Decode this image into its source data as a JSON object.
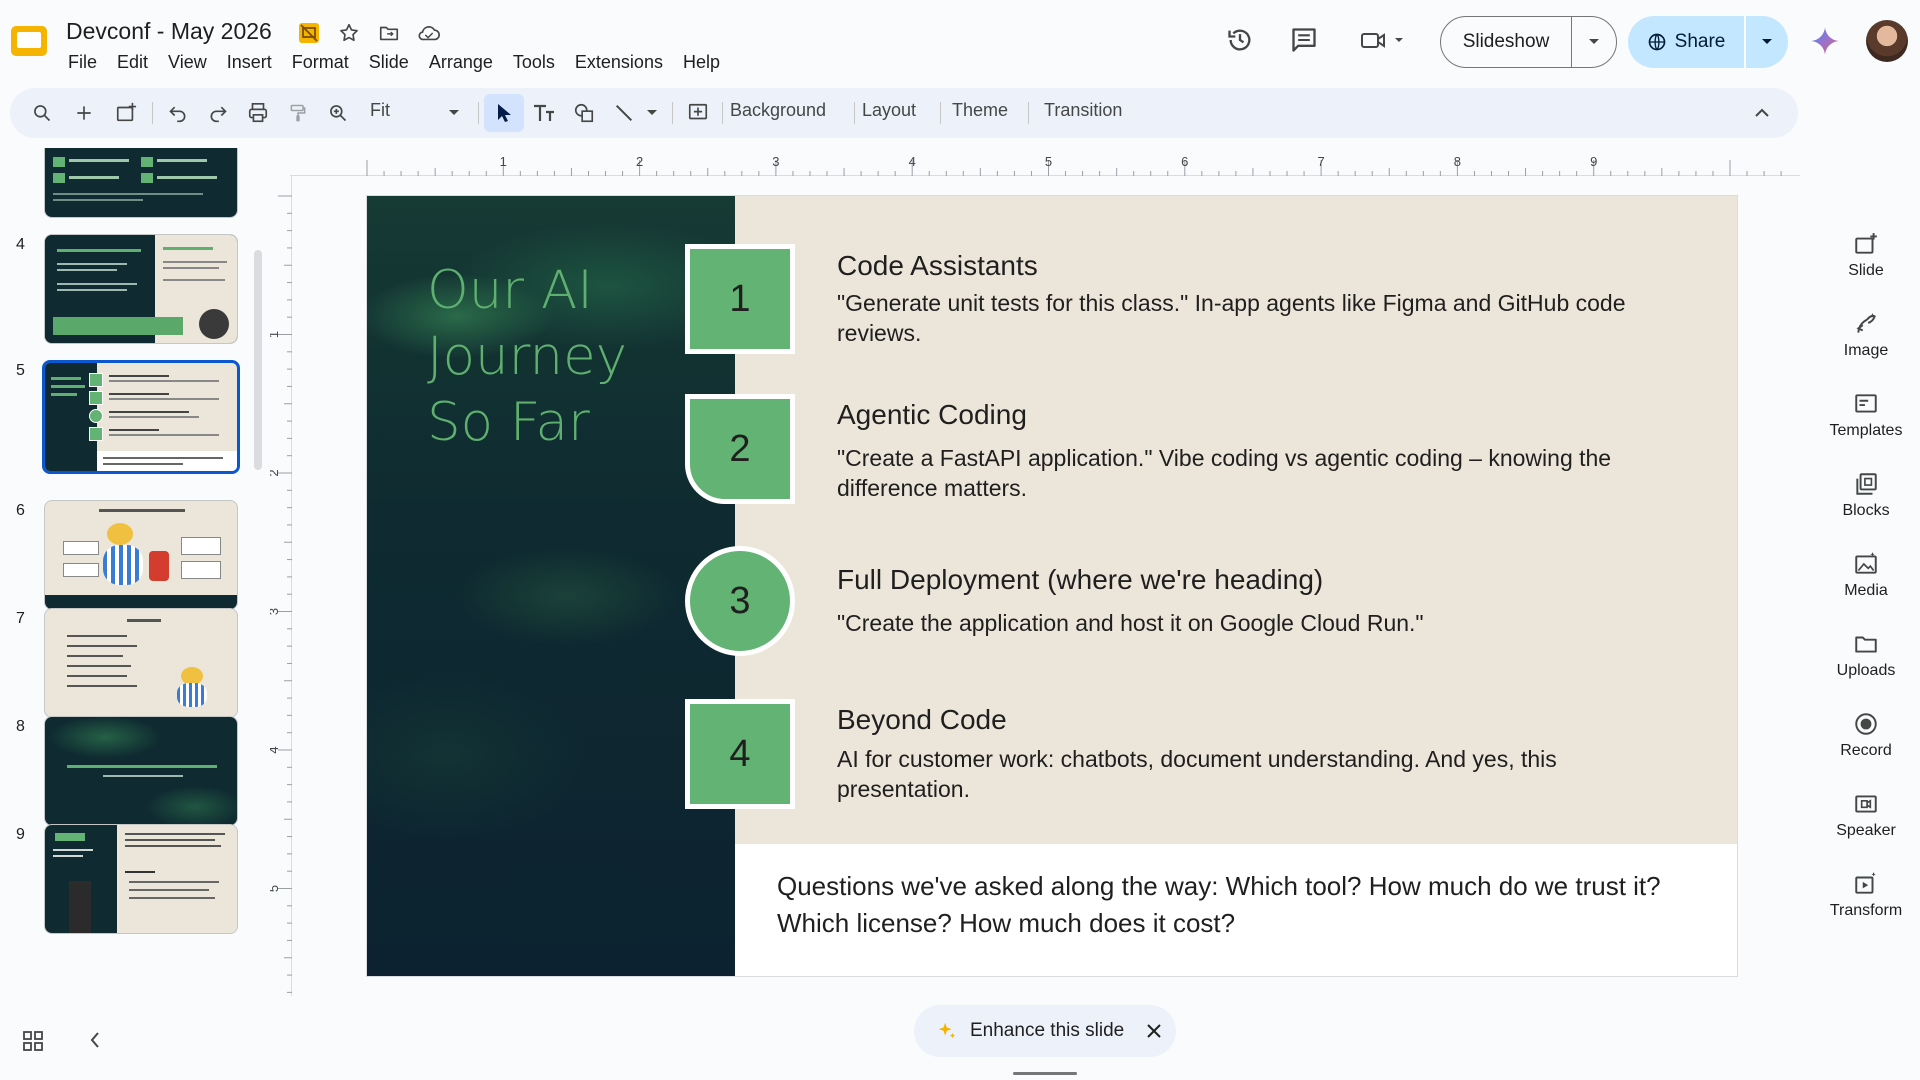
{
  "app": {
    "doc_title": "Devconf - May 2026",
    "menu": [
      "File",
      "Edit",
      "View",
      "Insert",
      "Format",
      "Slide",
      "Arrange",
      "Tools",
      "Extensions",
      "Help"
    ],
    "slideshow_label": "Slideshow",
    "share_label": "Share"
  },
  "toolbar": {
    "zoom": "Fit",
    "background": "Background",
    "layout": "Layout",
    "theme": "Theme",
    "transition": "Transition"
  },
  "ruler": {
    "h_ticks": [
      "1",
      "2",
      "3",
      "4",
      "5",
      "6",
      "7",
      "8",
      "9"
    ],
    "v_ticks": [
      "1",
      "2",
      "3",
      "4",
      "5"
    ]
  },
  "filmstrip": {
    "slides": [
      {
        "number": "",
        "style": "dark-partial"
      },
      {
        "number": "4",
        "style": "dark"
      },
      {
        "number": "5",
        "style": "selected"
      },
      {
        "number": "6",
        "style": "light-comic"
      },
      {
        "number": "7",
        "style": "light-list"
      },
      {
        "number": "8",
        "style": "dark-title"
      },
      {
        "number": "9",
        "style": "split"
      }
    ]
  },
  "slide": {
    "title_lines": [
      "Our AI",
      "Journey",
      "So Far"
    ],
    "items": [
      {
        "number": "1",
        "title": "Code Assistants",
        "desc": "\"Generate unit tests for this class.\" In-app agents like Figma and GitHub code reviews."
      },
      {
        "number": "2",
        "title": "Agentic Coding",
        "desc": "\"Create a FastAPI application.\" Vibe coding vs agentic coding – knowing the difference matters."
      },
      {
        "number": "3",
        "title": "Full Deployment (where we're heading)",
        "desc": "\"Create the application and host it on Google Cloud Run.\""
      },
      {
        "number": "4",
        "title": "Beyond Code",
        "desc": "AI for customer work: chatbots, document understanding. And yes, this presentation."
      }
    ],
    "question": "Questions we've asked along the way: Which tool? How much do we trust it? Which license? How much does it cost?",
    "colors": {
      "accent_green": "#62b374",
      "title_green": "#5fb06f",
      "dark_bg": "#0f2b31",
      "cream_bg": "#ece6da"
    }
  },
  "side_panel": {
    "items": [
      {
        "label": "Slide",
        "icon": "new-slide-icon"
      },
      {
        "label": "Image",
        "icon": "image-icon"
      },
      {
        "label": "Templates",
        "icon": "templates-icon"
      },
      {
        "label": "Blocks",
        "icon": "blocks-icon"
      },
      {
        "label": "Media",
        "icon": "media-icon"
      },
      {
        "label": "Uploads",
        "icon": "folder-icon"
      },
      {
        "label": "Record",
        "icon": "record-icon"
      },
      {
        "label": "Speaker",
        "icon": "speaker-icon"
      },
      {
        "label": "Transform",
        "icon": "transform-icon"
      }
    ]
  },
  "enhance": {
    "label": "Enhance this slide"
  }
}
